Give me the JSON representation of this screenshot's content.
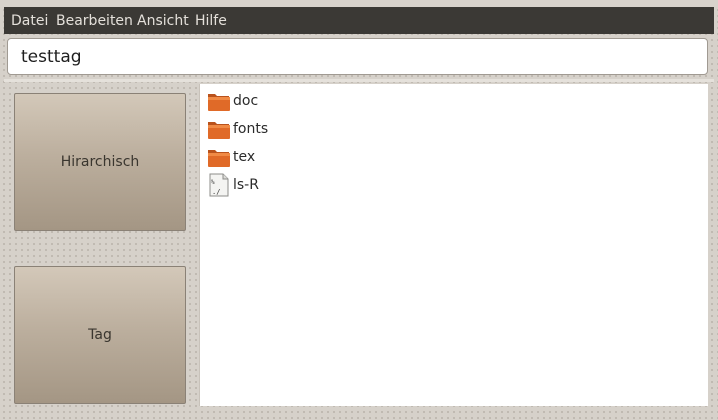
{
  "menubar": {
    "items": [
      {
        "label": "Datei"
      },
      {
        "label": "Bearbeiten"
      },
      {
        "label": "Ansicht"
      },
      {
        "label": "Hilfe"
      }
    ]
  },
  "path": {
    "value": "testtag"
  },
  "views": {
    "hierarchical_label": "Hirarchisch",
    "tag_label": "Tag"
  },
  "files": [
    {
      "name": "doc",
      "type": "folder",
      "icon": "folder-icon"
    },
    {
      "name": "fonts",
      "type": "folder",
      "icon": "folder-icon"
    },
    {
      "name": "tex",
      "type": "folder",
      "icon": "folder-icon"
    },
    {
      "name": "ls-R",
      "type": "file",
      "icon": "script-file-icon"
    }
  ],
  "colors": {
    "menubar_bg": "#3b3935",
    "folder_orange": "#e06a28",
    "button_top": "#d3c8b9",
    "button_bottom": "#a49684"
  }
}
